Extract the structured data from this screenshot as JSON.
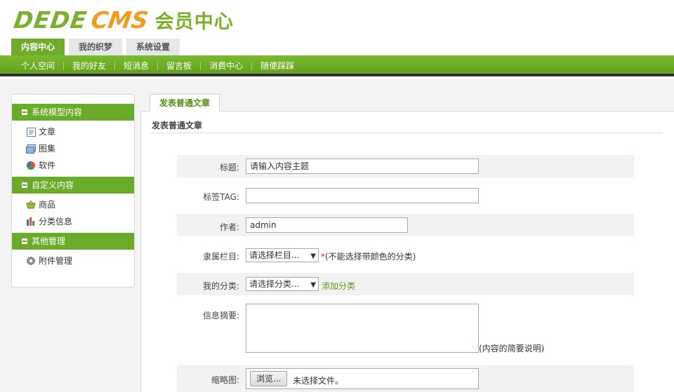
{
  "logo": {
    "part1": "DEDE",
    "part2": "CMS",
    "part3": "会员中心"
  },
  "top_tabs": [
    {
      "label": "内容中心",
      "active": true
    },
    {
      "label": "我的织梦",
      "active": false
    },
    {
      "label": "系统设置",
      "active": false
    }
  ],
  "nav": [
    "个人空间",
    "我的好友",
    "短消息",
    "留言板",
    "消费中心",
    "随便踩踩"
  ],
  "sidebar": {
    "groups": [
      {
        "title": "系统模型内容",
        "items": [
          {
            "label": "文章",
            "icon": "article-icon"
          },
          {
            "label": "图集",
            "icon": "gallery-icon"
          },
          {
            "label": "软件",
            "icon": "software-icon"
          }
        ]
      },
      {
        "title": "自定义内容",
        "items": [
          {
            "label": "商品",
            "icon": "basket-icon"
          },
          {
            "label": "分类信息",
            "icon": "chart-icon"
          }
        ]
      },
      {
        "title": "其他管理",
        "items": [
          {
            "label": "附件管理",
            "icon": "gear-icon"
          }
        ]
      }
    ]
  },
  "main": {
    "tab_label": "发表普通文章",
    "section_title": "发表普通文章",
    "form": {
      "title_label": "标题:",
      "title_value": "请输入内容主题",
      "tag_label": "标签TAG:",
      "tag_value": "",
      "author_label": "作者:",
      "author_value": "admin",
      "column_label": "隶属栏目:",
      "column_selected": "请选择栏目...",
      "column_required_mark": "*",
      "column_note": "(不能选择带颜色的分类)",
      "category_label": "我的分类:",
      "category_selected": "请选择分类...",
      "category_add_link": "添加分类",
      "summary_label": "信息摘要:",
      "summary_value": "",
      "summary_note": "(内容的简要说明)",
      "thumb_label": "缩略图:",
      "thumb_button": "浏览...",
      "thumb_status": "未选择文件。"
    }
  },
  "colors": {
    "brand_green": "#6aab29",
    "logo_orange": "#f29c1f",
    "required_red": "#e02020"
  }
}
